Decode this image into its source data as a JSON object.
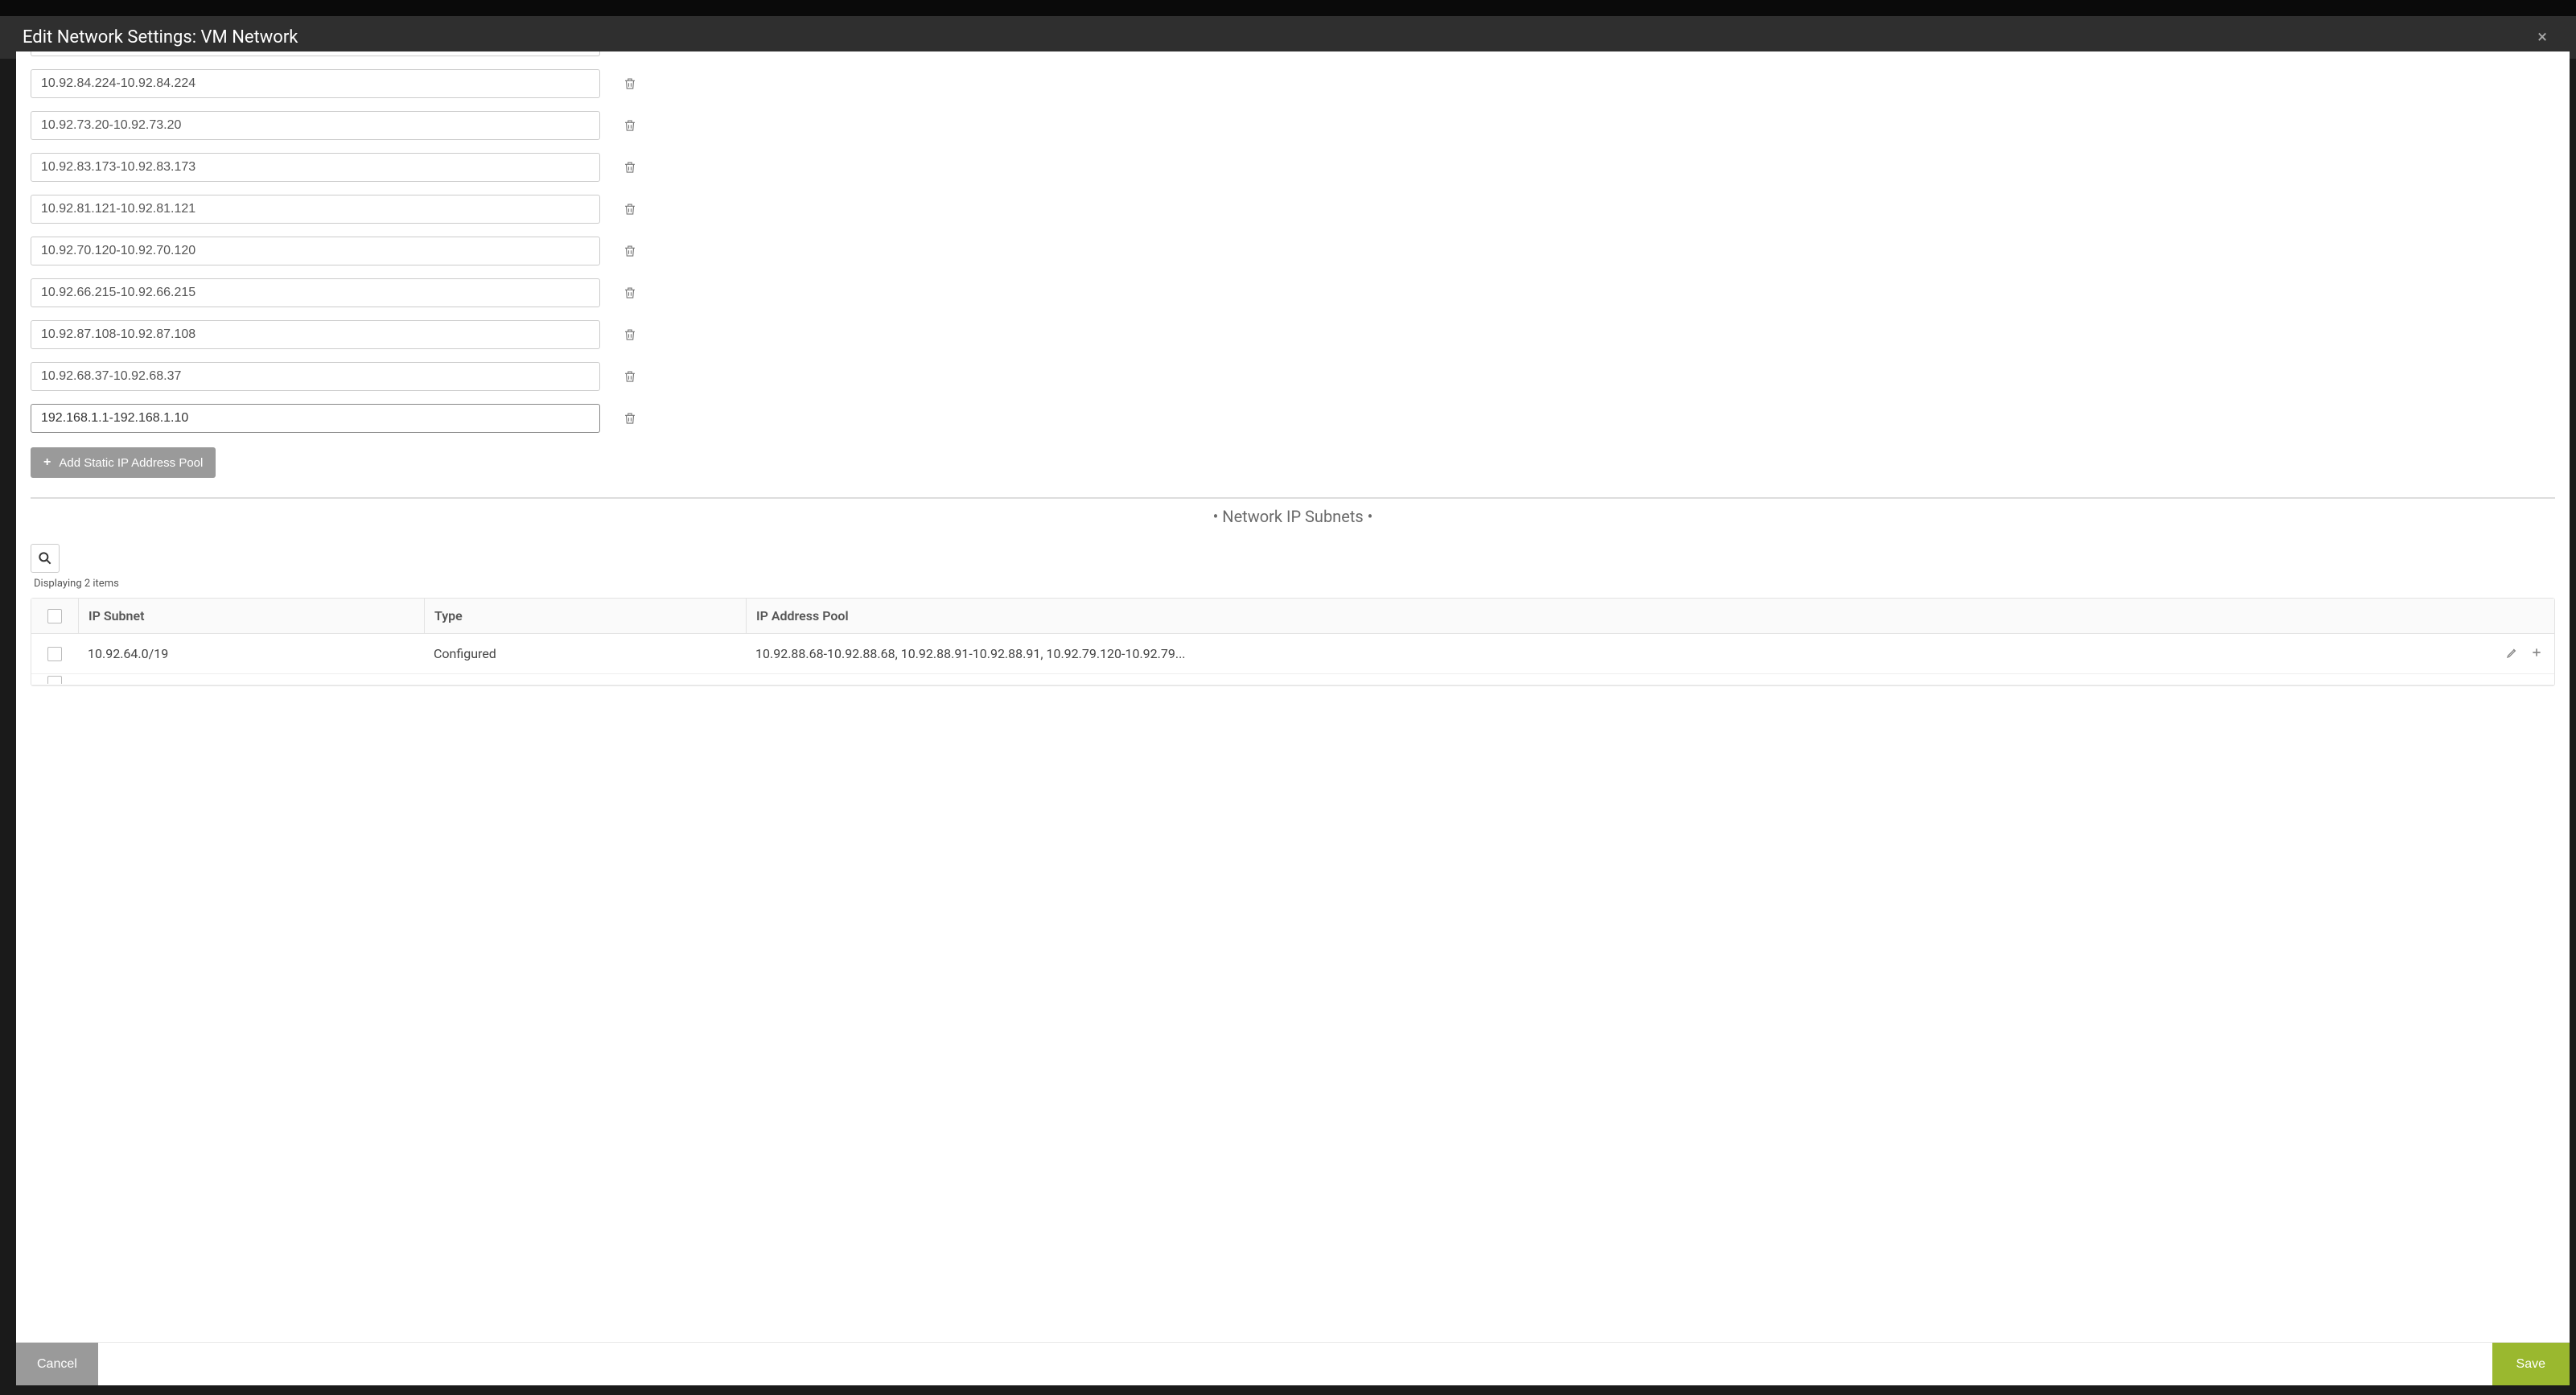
{
  "modal": {
    "title": "Edit Network Settings: VM Network",
    "close_label": "×"
  },
  "ip_pools": {
    "partial_top_visible": true,
    "items": [
      "10.92.84.224-10.92.84.224",
      "10.92.73.20-10.92.73.20",
      "10.92.83.173-10.92.83.173",
      "10.92.81.121-10.92.81.121",
      "10.92.70.120-10.92.70.120",
      "10.92.66.215-10.92.66.215",
      "10.92.87.108-10.92.87.108",
      "10.92.68.37-10.92.68.37",
      "192.168.1.1-192.168.1.10"
    ],
    "add_button_label": "Add Static IP Address Pool"
  },
  "subnet_section": {
    "title": "•  Network IP Subnets  •",
    "count_label": "Displaying 2 items",
    "headers": {
      "subnet": "IP Subnet",
      "type": "Type",
      "pool": "IP Address Pool"
    },
    "rows": [
      {
        "subnet": "10.92.64.0/19",
        "type": "Configured",
        "pool": "10.92.88.68-10.92.88.68, 10.92.88.91-10.92.88.91, 10.92.79.120-10.92.79..."
      }
    ]
  },
  "footer": {
    "cancel_label": "Cancel",
    "save_label": "Save"
  },
  "icons": {
    "trash": "trash-icon",
    "search": "search-icon",
    "edit": "pencil-icon",
    "add": "plus-icon"
  }
}
